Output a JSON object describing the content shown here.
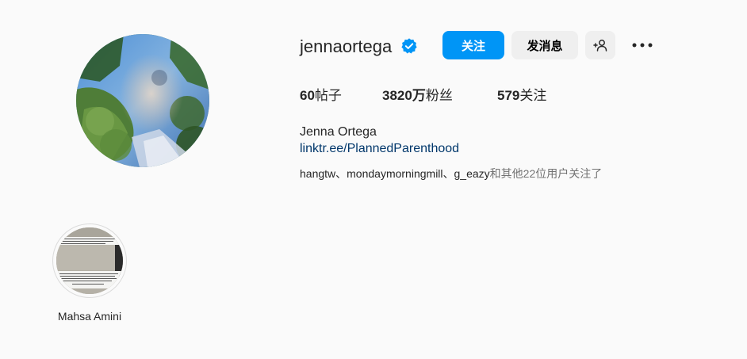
{
  "profile": {
    "username": "jennaortega",
    "verified": true,
    "full_name": "Jenna Ortega",
    "link": "linktr.ee/PlannedParenthood",
    "avatar_icon": "profile-photo"
  },
  "actions": {
    "follow_label": "关注",
    "message_label": "发消息",
    "suggest_icon": "add-person-icon",
    "more_icon": "more-horizontal-icon"
  },
  "stats": {
    "posts_count": "60",
    "posts_label": "帖子",
    "followers_count": "3820万",
    "followers_label": "粉丝",
    "following_count": "579",
    "following_label": "关注"
  },
  "followed_by": {
    "names": "hangtw、mondaymorningmill、g_eazy",
    "suffix": "和其他22位用户关注了"
  },
  "highlights": [
    {
      "label": "Mahsa Amini"
    }
  ],
  "colors": {
    "primary_button": "#0095f6",
    "secondary_button": "#efefef",
    "link": "#00376b",
    "verified_badge": "#0095f6",
    "background": "#fafafa"
  }
}
